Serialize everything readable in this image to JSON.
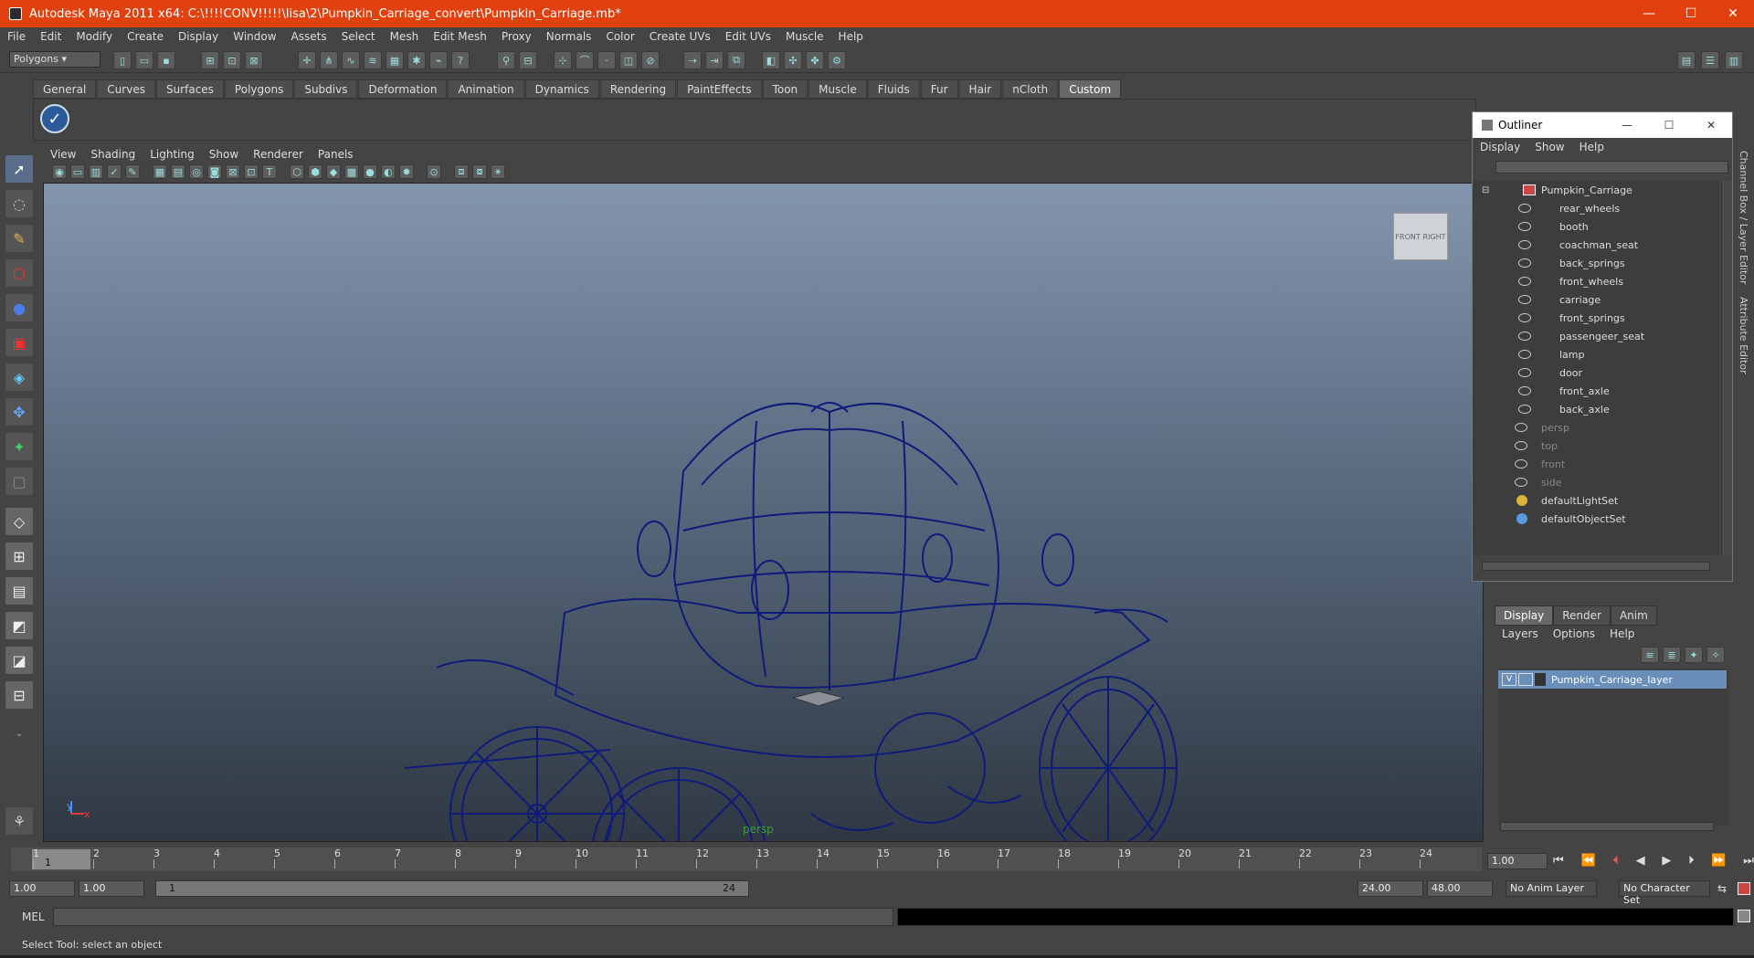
{
  "window": {
    "title": "Autodesk Maya 2011 x64: C:\\!!!!CONV!!!!!\\lisa\\2\\Pumpkin_Carriage_convert\\Pumpkin_Carriage.mb*",
    "minimize": "—",
    "maximize": "☐",
    "close": "✕"
  },
  "menubar": [
    "File",
    "Edit",
    "Modify",
    "Create",
    "Display",
    "Window",
    "Assets",
    "Select",
    "Mesh",
    "Edit Mesh",
    "Proxy",
    "Normals",
    "Color",
    "Create UVs",
    "Edit UVs",
    "Muscle",
    "Help"
  ],
  "statusline": {
    "mode": "Polygons"
  },
  "shelf": {
    "tabs": [
      "General",
      "Curves",
      "Surfaces",
      "Polygons",
      "Subdivs",
      "Deformation",
      "Animation",
      "Dynamics",
      "Rendering",
      "PaintEffects",
      "Toon",
      "Muscle",
      "Fluids",
      "Fur",
      "Hair",
      "nCloth",
      "Custom"
    ],
    "active_tab": "Custom"
  },
  "viewport": {
    "menu": [
      "View",
      "Shading",
      "Lighting",
      "Show",
      "Renderer",
      "Panels"
    ],
    "camera": "persp",
    "viewcube_front": "FRONT",
    "viewcube_right": "RIGHT",
    "axis_y": "y",
    "axis_x": "x"
  },
  "outliner": {
    "title": "Outliner",
    "menu": [
      "Display",
      "Show",
      "Help"
    ],
    "root": "Pumpkin_Carriage",
    "children": [
      "rear_wheels",
      "booth",
      "coachman_seat",
      "back_springs",
      "front_wheels",
      "carriage",
      "front_springs",
      "passengeer_seat",
      "lamp",
      "door",
      "front_axle",
      "back_axle"
    ],
    "cameras": [
      "persp",
      "top",
      "front",
      "side"
    ],
    "sets": [
      "defaultLightSet",
      "defaultObjectSet"
    ]
  },
  "layer_editor": {
    "tabs": [
      "Display",
      "Render",
      "Anim"
    ],
    "active_tab": "Display",
    "menu": [
      "Layers",
      "Options",
      "Help"
    ],
    "layer_name": "Pumpkin_Carriage_layer",
    "visible_flag": "V"
  },
  "side_tabs": [
    "Channel Box / Layer Editor",
    "Attribute Editor"
  ],
  "timeline": {
    "ticks": [
      "1",
      "2",
      "3",
      "4",
      "5",
      "6",
      "7",
      "8",
      "9",
      "10",
      "11",
      "12",
      "13",
      "14",
      "15",
      "16",
      "17",
      "18",
      "19",
      "20",
      "21",
      "22",
      "23",
      "24"
    ],
    "current_frame": "1",
    "current_time_field": "1.00"
  },
  "range": {
    "start": "1.00",
    "playback_start": "1.00",
    "slider_start": "1",
    "slider_end": "24",
    "playback_end": "24.00",
    "end": "48.00",
    "anim_layer": "No Anim Layer",
    "character_set": "No Character Set"
  },
  "command": {
    "label": "MEL"
  },
  "helpline": "Select Tool: select an object"
}
